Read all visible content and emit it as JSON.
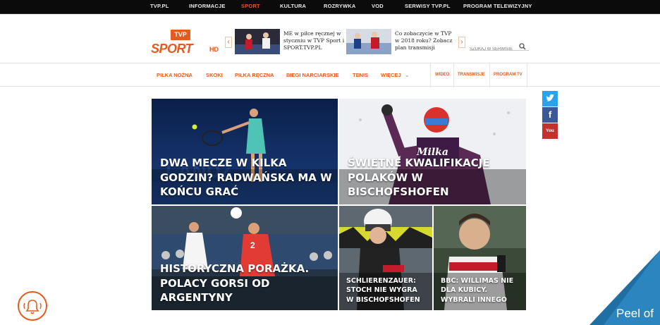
{
  "top_nav": [
    "TVP.PL",
    "INFORMACJE",
    "SPORT",
    "KULTURA",
    "ROZRYWKA",
    "VOD",
    "SERWISY TVP.PL",
    "PROGRAM TELEWIZYJNY"
  ],
  "logo": {
    "tvp": "TVP",
    "sport": "SPORT",
    "hd": "HD"
  },
  "promos": [
    {
      "text": "ME w piłce ręcznej w styczniu w TVP Sport i SPORT.TVP.PL"
    },
    {
      "text": "Co zobaczycie w TVP w 2018 roku? Zobacz plan transmisji"
    }
  ],
  "search": {
    "placeholder": "SZUKAJ W SERWISIE"
  },
  "category_nav": [
    "PIŁKA NOŻNA",
    "SKOKI",
    "PIŁKA RĘCZNA",
    "BIEGI NARCIARSKIE",
    "TENIS",
    "WIĘCEJ"
  ],
  "category_nav_extra": [
    "WIDEO",
    "TRANSMISJE",
    "PROGRAM TV"
  ],
  "tiles": [
    {
      "caption": "DWA MECZE W KILKA GODZIN? RADWAŃSKA MA W KOŃCU GRAĆ"
    },
    {
      "caption": "ŚWIETNE KWALIFIKACJE POLAKÓW W BISCHOFSHOFEN"
    },
    {
      "caption": "HISTORYCZNA PORAŻKA. POLACY GORSI OD ARGENTYNY"
    },
    {
      "caption": "SCHLIERENZAUER: STOCH NIE WYGRA W BISCHOFSHOFEN"
    },
    {
      "caption": "BBC: WILLIMAS NIE DLA KUBICY. WYBRALI INNEGO"
    }
  ],
  "social": {
    "twitter": "twitter",
    "facebook": "f",
    "youtube": "You"
  },
  "peel": {
    "label": "Peel of"
  },
  "colors": {
    "accent": "#e35b1e",
    "topbar": "#0b0b0b",
    "twitter": "#2aa3ef",
    "facebook": "#3b5998",
    "youtube": "#c4302b"
  }
}
